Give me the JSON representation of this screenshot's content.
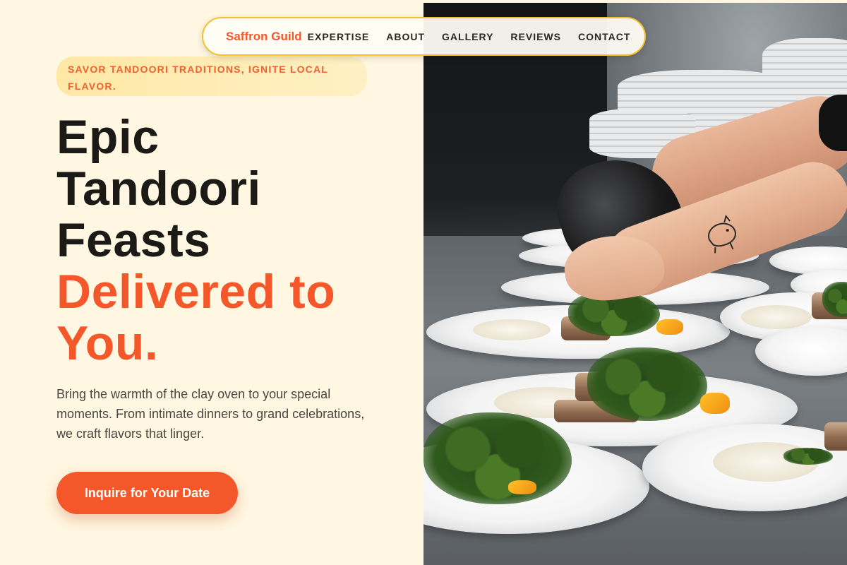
{
  "nav": {
    "brand": "Saffron Guild",
    "links": [
      "EXPERTISE",
      "ABOUT",
      "GALLERY",
      "REVIEWS",
      "CONTACT"
    ]
  },
  "hero": {
    "tagline": "SAVOR TANDOORI TRADITIONS, IGNITE LOCAL FLAVOR.",
    "headline_lines": [
      "Epic",
      "Tandoori",
      "Feasts"
    ],
    "headline_accent_lines": [
      "Delivered to",
      "You."
    ],
    "intro": "Bring the warmth of the clay oven to your special moments. From intimate dinners to grand celebrations, we craft flavors that linger.",
    "cta_label": "Inquire for Your Date"
  },
  "colors": {
    "accent": "#f4572a",
    "page_background": "#fff7e1",
    "nav_border": "#f4c228",
    "heading": "#1c1a17"
  },
  "image": {
    "subject": "chefs plating tandoori dishes with greens on white plates"
  }
}
